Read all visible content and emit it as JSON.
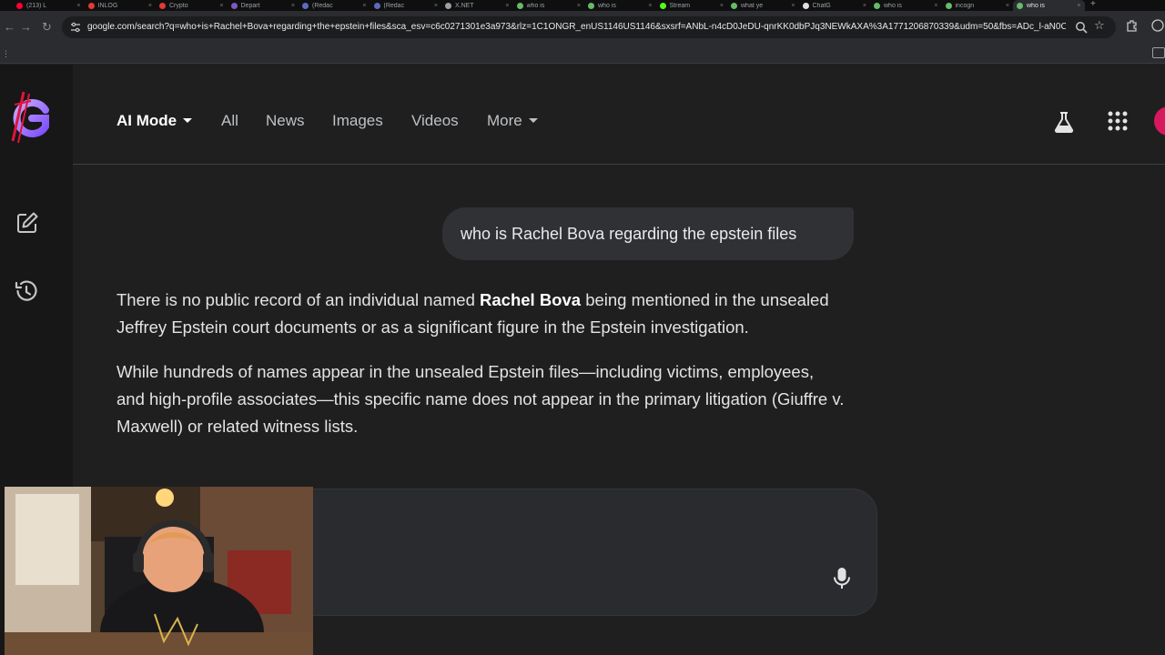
{
  "browser": {
    "tabs": [
      {
        "title": "(213) L",
        "color": "#ff0033"
      },
      {
        "title": "INLOG",
        "color": "#e53935"
      },
      {
        "title": "Crypto",
        "color": "#e53935"
      },
      {
        "title": "Depart",
        "color": "#7e57c2"
      },
      {
        "title": "(Redac",
        "color": "#5c6bc0"
      },
      {
        "title": "(Redac",
        "color": "#5c6bc0"
      },
      {
        "title": "X.NET",
        "color": "#9aa0a6"
      },
      {
        "title": "who is",
        "color": "#66bb6a"
      },
      {
        "title": "who is",
        "color": "#66bb6a"
      },
      {
        "title": "Stream",
        "color": "#53fc18"
      },
      {
        "title": "what ye",
        "color": "#66bb6a"
      },
      {
        "title": "ChatG",
        "color": "#e0e0e0"
      },
      {
        "title": "who is",
        "color": "#66bb6a"
      },
      {
        "title": "incogn",
        "color": "#66bb6a"
      },
      {
        "title": "who is",
        "color": "#66bb6a",
        "active": true
      }
    ],
    "url": "google.com/search?q=who+is+Rachel+Bova+regarding+the+epstein+files&sca_esv=c6c0271301e3a973&rlz=1C1ONGR_enUS1146US1146&sxsrf=ANbL-n4cD0JeDU-qnrKK0dbPJq3NEWkAXA%3A1771206870339&udm=50&fbs=ADc_l-aN0CW..."
  },
  "header": {
    "nav": {
      "ai_mode": "AI Mode",
      "all": "All",
      "news": "News",
      "images": "Images",
      "videos": "Videos",
      "more": "More"
    }
  },
  "conversation": {
    "query": "who is Rachel Bova regarding the epstein files",
    "answer": {
      "p1_before": "There is no public record of an individual named ",
      "p1_bold": "Rachel Bova",
      "p1_after": " being mentioned in the unsealed Jeffrey Epstein court documents or as a significant figure in the Epstein investigation.",
      "p2": "While hundreds of names appear in the unsealed Epstein files—including victims, employees, and high-profile associates—this specific name does not appear in the primary litigation (Giuffre v. Maxwell) or related witness lists."
    }
  },
  "colors": {
    "page_bg": "#1f1f1f",
    "rail_bg": "#171717",
    "avatar": "#d6185e",
    "logo_purple": "#a57cf0",
    "logo_red": "#e0143c"
  },
  "icons": {
    "logo": "g-logo-icon",
    "new_chat": "edit-icon",
    "history": "history-icon",
    "labs": "flask-icon",
    "apps": "apps-grid-icon",
    "mic": "mic-icon"
  }
}
